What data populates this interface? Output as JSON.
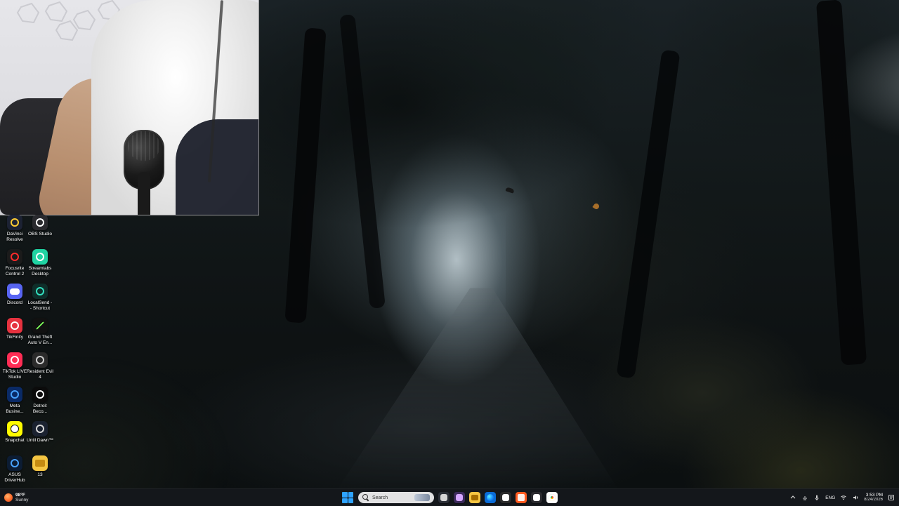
{
  "desktop": {
    "icons": [
      {
        "id": "davinci",
        "label": "DaVinci\nResolve",
        "icon": "davinci-resolve-icon",
        "bg": "#1c2233",
        "accent": "#ffcc33"
      },
      {
        "id": "obs",
        "label": "OBS Studio",
        "icon": "obs-studio-icon",
        "bg": "#2a2a2e",
        "accent": "#ffffff"
      },
      {
        "id": "focusrite",
        "label": "Focusrite\nControl 2",
        "icon": "focusrite-icon",
        "bg": "#1b1b1b",
        "accent": "#ff2b2b"
      },
      {
        "id": "streamlabs",
        "label": "Streamlabs\nDesktop",
        "icon": "streamlabs-icon",
        "bg": "#20d3a2",
        "accent": "#ffffff"
      },
      {
        "id": "discord",
        "label": "Discord",
        "icon": "discord-icon",
        "bg": "#5865f2",
        "accent": "#ffffff"
      },
      {
        "id": "localsend",
        "label": "LocalSend -\n- Shortcut",
        "icon": "localsend-icon",
        "bg": "#0f2e2a",
        "accent": "#33e0c0"
      },
      {
        "id": "tikfinity",
        "label": "TikFinity",
        "icon": "tikfinity-icon",
        "bg": "#e6323f",
        "accent": "#ffffff"
      },
      {
        "id": "gta",
        "label": "Grand Theft\nAuto V En...",
        "icon": "gta-v-icon",
        "bg": "#111111",
        "accent": "#7dff5a"
      },
      {
        "id": "tiktok-live",
        "label": "TikTok LIVE\nStudio",
        "icon": "tiktok-live-studio-icon",
        "bg": "#ff2d55",
        "accent": "#ffffff"
      },
      {
        "id": "re4",
        "label": "Resident Evil\n4",
        "icon": "resident-evil-4-icon",
        "bg": "#2b2b2b",
        "accent": "#cfcfcf"
      },
      {
        "id": "meta",
        "label": "Meta\nBusine...",
        "icon": "meta-business-icon",
        "bg": "#0a2a66",
        "accent": "#47a3ff"
      },
      {
        "id": "detroit",
        "label": "Detroit\nBeco...",
        "icon": "detroit-icon",
        "bg": "#0b0b0b",
        "accent": "#ffffff"
      },
      {
        "id": "snapchat",
        "label": "Snapchat",
        "icon": "snapchat-icon",
        "bg": "#fffc00",
        "accent": "#111111"
      },
      {
        "id": "until-dawn",
        "label": "Until Dawn™",
        "icon": "until-dawn-icon",
        "bg": "#1b2230",
        "accent": "#d7d7d7"
      },
      {
        "id": "asus",
        "label": "ASUS\nDriverHub",
        "icon": "asus-driverhub-icon",
        "bg": "#0c1c33",
        "accent": "#49a2ff"
      },
      {
        "id": "folder-13",
        "label": "13",
        "icon": "folder-icon",
        "bg": "#f4c542",
        "accent": "#c58b12"
      }
    ]
  },
  "taskbar": {
    "weather": {
      "temp": "98°F",
      "condition": "Sunny",
      "icon": "weather-sun-icon"
    },
    "search": {
      "placeholder": "Search"
    },
    "pinned": [
      {
        "name": "task-view",
        "icon": "task-view-icon",
        "bg": "#2a2e36",
        "accent": "#d6d6d6"
      },
      {
        "name": "copilot",
        "icon": "copilot-icon",
        "bg": "#3b2a5a",
        "accent": "#d5a6ff"
      },
      {
        "name": "file-explorer",
        "icon": "file-explorer-icon",
        "bg": "#f5c542",
        "accent": "#a56d00"
      },
      {
        "name": "edge",
        "icon": "edge-icon",
        "bg": "#0a6bd6",
        "accent": "#32d2ff"
      },
      {
        "name": "microsoft-store",
        "icon": "microsoft-store-icon",
        "bg": "#2b2b2b",
        "accent": "#ffffff"
      },
      {
        "name": "brave",
        "icon": "brave-icon",
        "bg": "#ff5a1f",
        "accent": "#ffffff"
      },
      {
        "name": "obs-taskbar",
        "icon": "obs-taskbar-icon",
        "bg": "#2a2a2e",
        "accent": "#ffffff"
      },
      {
        "name": "chrome",
        "icon": "chrome-icon",
        "bg": "#ffffff",
        "accent": "#34a853"
      }
    ],
    "tray": {
      "language": "ENG",
      "time": "3:53 PM",
      "date": "8/24/2026",
      "icons": [
        "chevron-up-icon",
        "network-icon",
        "mic-icon",
        "wifi-icon",
        "volume-icon",
        "notification-icon"
      ]
    }
  }
}
